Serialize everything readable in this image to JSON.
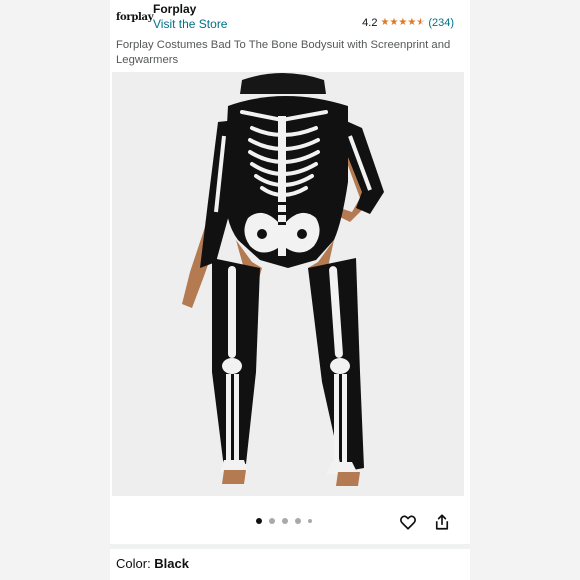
{
  "brand": {
    "logo_text": "forplay",
    "name": "Forplay",
    "store_link": "Visit the Store"
  },
  "rating": {
    "value": "4.2",
    "stars": 4.2,
    "count": "(234)",
    "star_color": "#de7921"
  },
  "product": {
    "title": "Forplay Costumes Bad To The Bone Bodysuit with Screenprint and Legwarmers"
  },
  "gallery": {
    "image_icon": "product-photo",
    "dots_total": 5,
    "active_index": 0,
    "favorite_icon": "heart-icon",
    "share_icon": "share-icon"
  },
  "variant": {
    "color_label": "Color:",
    "color_value": "Black"
  },
  "colors": {
    "link": "#007185",
    "text": "#0f1111",
    "muted": "#565959"
  }
}
